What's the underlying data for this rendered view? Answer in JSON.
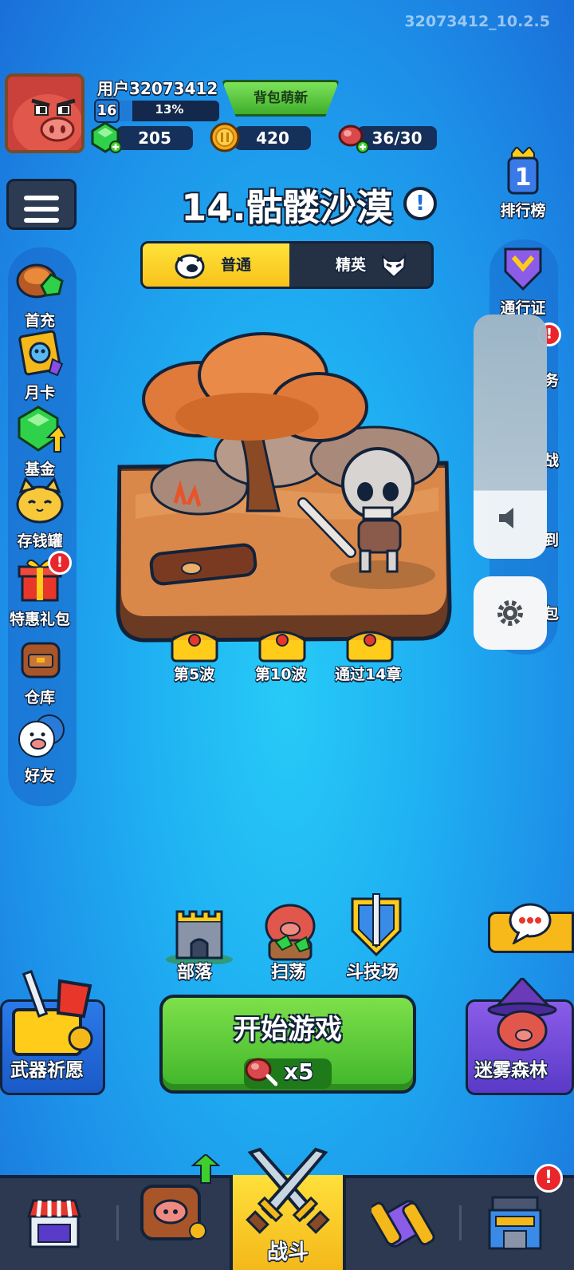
{
  "version": "32073412_10.2.5",
  "profile": {
    "username": "用户32073412",
    "level": "16",
    "xp_percent": "13%",
    "xp_fraction": 0.13,
    "bag_button": "背包萌新"
  },
  "resources": {
    "gems": "205",
    "coins": "420",
    "energy": "36/30"
  },
  "chapter": {
    "title": "14.骷髅沙漠",
    "info": "!"
  },
  "modes": {
    "normal": "普通",
    "elite": "精英",
    "selected": "normal"
  },
  "left_sidebar": {
    "items": [
      {
        "label": "首充"
      },
      {
        "label": "月卡"
      },
      {
        "label": "基金"
      },
      {
        "label": "存钱罐"
      },
      {
        "label": "特惠礼包",
        "alert": "!"
      },
      {
        "label": "仓库"
      },
      {
        "label": "好友"
      }
    ]
  },
  "right_sidebar": {
    "items": [
      {
        "label": "排行榜"
      },
      {
        "label": "通行证"
      },
      {
        "label": "务"
      },
      {
        "label": "战"
      },
      {
        "label": "到"
      },
      {
        "label": "包"
      }
    ],
    "alert": "!"
  },
  "rewards": {
    "items": [
      "第5波",
      "第10波",
      "通过14章"
    ]
  },
  "game_modes": {
    "items": [
      "部落",
      "扫荡",
      "斗技场"
    ]
  },
  "start": {
    "label": "开始游戏",
    "cost": "x5"
  },
  "side_cards": {
    "left": "武器祈愿",
    "right": "迷雾森林"
  },
  "bottom_nav": {
    "active_label": "战斗",
    "alert": "!"
  },
  "colors": {
    "background": "#1fb0f2",
    "start_green": "#3fb52a",
    "tab_yellow": "#f7c21a",
    "alert_red": "#e8262b",
    "outline": "#12223a"
  }
}
